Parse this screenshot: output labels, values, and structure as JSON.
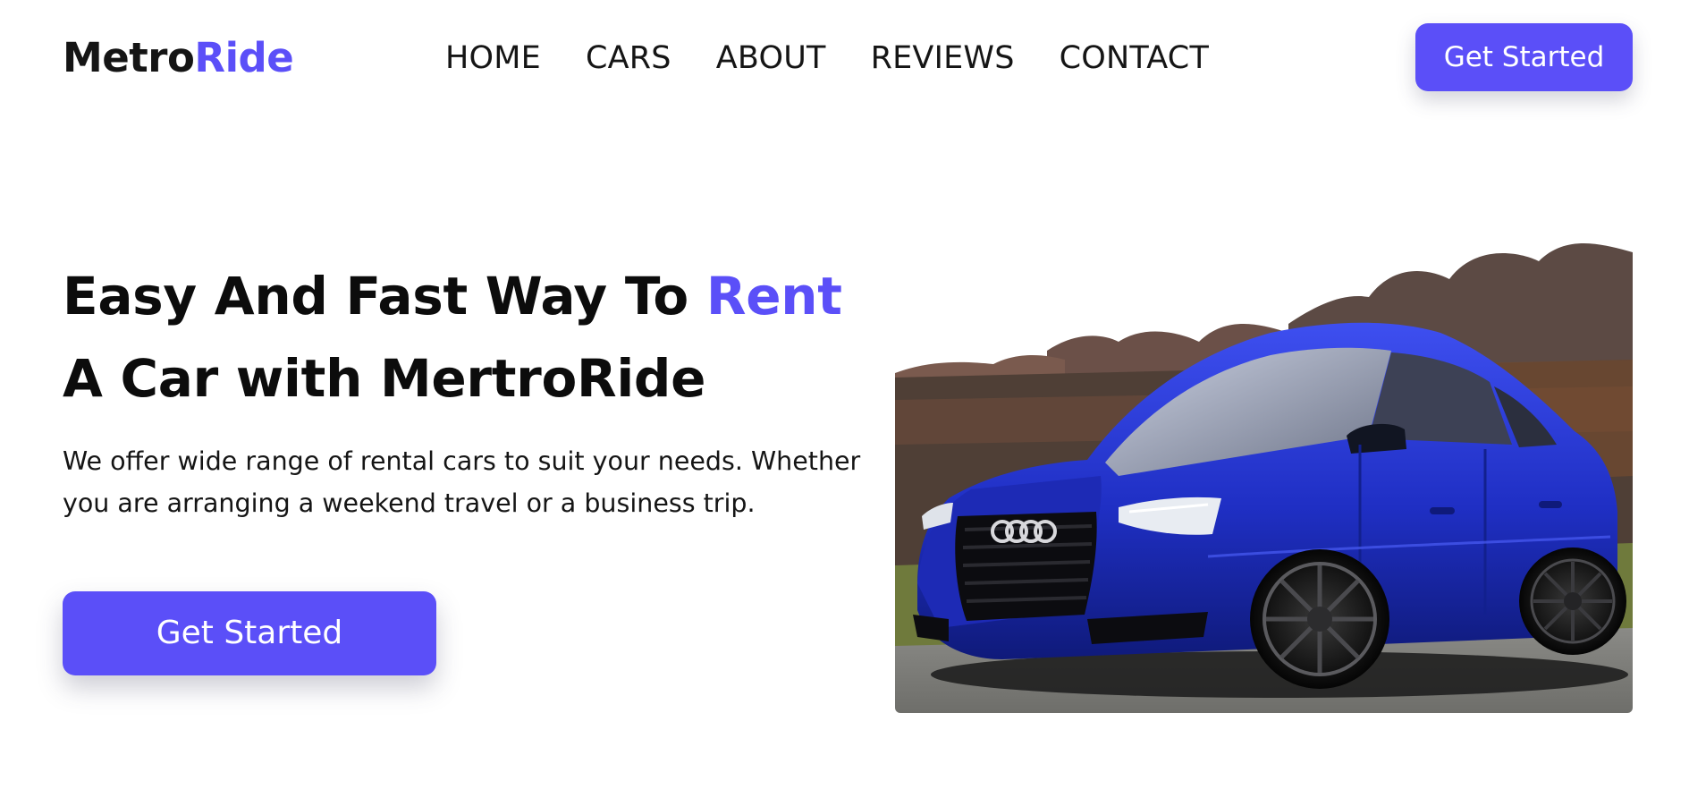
{
  "brand": {
    "name_part1": "Metro",
    "name_part2": "Ride",
    "accent_color": "#5b4ff8"
  },
  "nav": {
    "items": [
      "HOME",
      "CARS",
      "ABOUT",
      "REVIEWS",
      "CONTACT"
    ]
  },
  "header": {
    "cta_label": "Get Started"
  },
  "hero": {
    "title_before": "Easy And Fast Way To ",
    "title_accent": "Rent",
    "title_after": " A Car with MertroRide",
    "description": "We offer wide range of rental cars to suit your needs. Whether you are arranging a weekend travel or a business trip.",
    "cta_label": "Get Started",
    "image_subject": "blue-sedan-car-photo"
  }
}
